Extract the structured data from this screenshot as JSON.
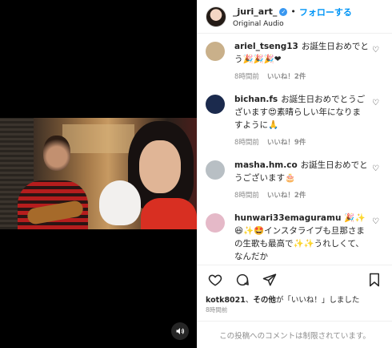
{
  "header": {
    "username": "_juri_art_",
    "separator": "•",
    "follow_label": "フォローする",
    "audio_label": "Original Audio"
  },
  "comments": [
    {
      "username": "ariel_tseng13",
      "text": "お誕生日おめでとう🎉🎉🎉❤",
      "time": "8時間前",
      "likes": "いいね！2件",
      "avatar_color": "#c9b08a"
    },
    {
      "username": "bichan.fs",
      "text": "お誕生日おめでとうございます😍素晴らしい年になりますように🙏",
      "time": "8時間前",
      "likes": "いいね！9件",
      "avatar_color": "#1b2a4d"
    },
    {
      "username": "masha.hm.co",
      "text": "お誕生日おめでとうございます🎂",
      "time": "8時間前",
      "likes": "いいね！2件",
      "avatar_color": "#b8bfc4"
    },
    {
      "username": "hunwari33emaguramu",
      "text": "🎉✨😆✨🤩インスタライブも旦那さまの生歌も最高で✨✨うれしくて、なんだか",
      "time": "",
      "likes": "",
      "avatar_color": "#e5b9c8"
    }
  ],
  "liked_by": {
    "user": "kotk8021",
    "sep": "、",
    "others": "その他",
    "suffix": "が「いいね！」しました"
  },
  "post_date": "8時間前",
  "comments_disabled": "この投稿へのコメントは制限されています。",
  "colors": {
    "accent": "#0095f6",
    "verified": "#3897f0",
    "muted": "#8e8e8e"
  }
}
